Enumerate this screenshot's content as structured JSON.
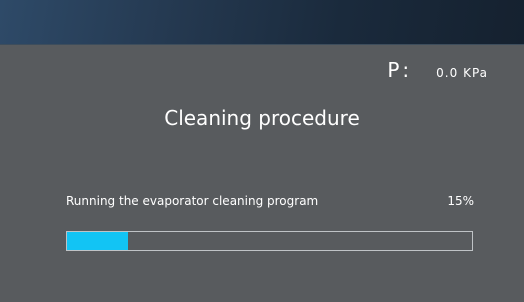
{
  "header": {
    "pressure_label": "P:",
    "pressure_value": "0.0 KPa"
  },
  "main": {
    "title": "Cleaning procedure",
    "status_text": "Running the evaporator cleaning program",
    "progress_text": "15%",
    "progress_percent": 15
  },
  "colors": {
    "background": "#585b5e",
    "top_bar": "#1f3147",
    "progress_fill": "#12c4f4",
    "progress_border": "#bfc3c6",
    "text": "#ffffff"
  }
}
